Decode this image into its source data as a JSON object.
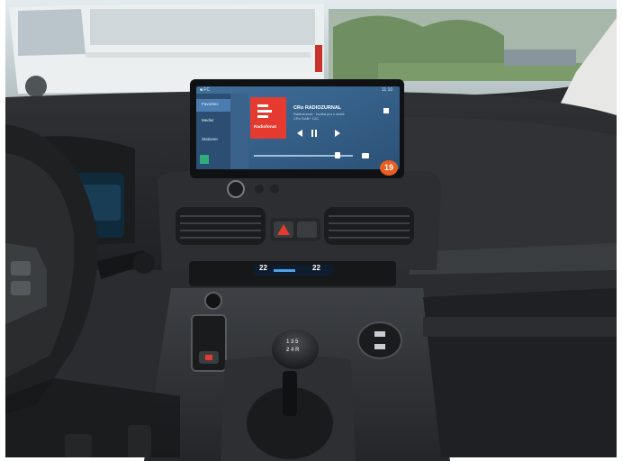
{
  "scene": {
    "colors": {
      "sky": "#dce6ea",
      "rain_glass": "#c9d5d6",
      "van_white": "#eef0ef",
      "dashboard_dark": "#323436",
      "dashboard_mid": "#4b4e52",
      "dashboard_light": "#6a6e73",
      "screen_blue": "#4a7dad",
      "screen_bg": "#2e4f70",
      "radio_red": "#e53a2f",
      "badge_orange": "#e85d22",
      "gear_black": "#1e1f21",
      "trees": "#6d8f63"
    }
  },
  "infotainment": {
    "status_left": "■ FC",
    "status_time": "11:10",
    "menu": [
      {
        "label": "Favorites"
      },
      {
        "label": "Medier"
      },
      {
        "label": "Stationer"
      }
    ],
    "station_logo_label": "Radiofonat",
    "station_title": "CRo RADIOZURNAL",
    "station_line1": "Radiožurnál · hudba pro v cestě",
    "station_line2": "CRo DAB+ 12C",
    "marker_number": "19"
  },
  "climate": {
    "left_temp": "22",
    "right_temp": "22"
  },
  "gear_knob": {
    "row1": "1 3 5",
    "row2": "2 4 R"
  }
}
